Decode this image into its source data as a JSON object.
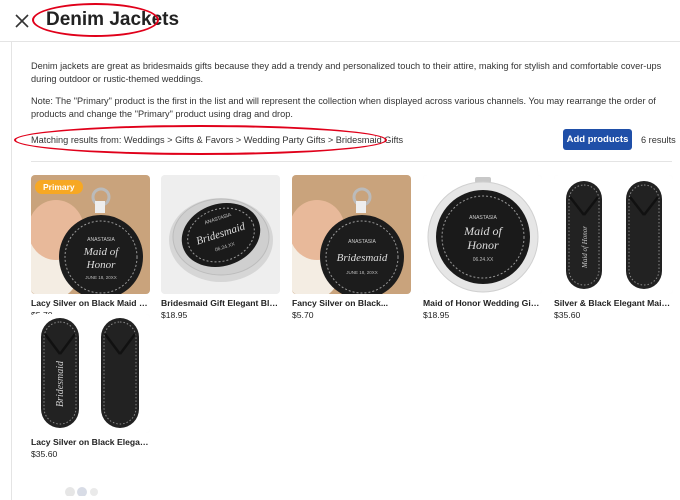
{
  "header": {
    "title": "Denim Jackets"
  },
  "description": {
    "paragraph1": "Denim jackets are great as bridesmaids gifts because they add a trendy and personalized touch to their attire, making for stylish and comfortable cover-ups during outdoor or rustic-themed weddings.",
    "paragraph2": "Note: The \"Primary\" product is the first in the list and will represent the collection when displayed across various channels. You may rearrange the order of products and change the \"Primary\" product using drag and drop."
  },
  "breadcrumb": "Matching results from: Weddings > Gifts & Favors > Wedding Party Gifts > Bridesmaid Gifts",
  "actions": {
    "add_products_label": "Add products",
    "results_count": "6 results"
  },
  "products": [
    {
      "name": "Lacy Silver on Black Maid of...",
      "price": "$5.70",
      "badge": "Primary",
      "image_text": [
        "ANASTASIA",
        "Maid of",
        "Honor",
        "JUNE 18, 20XX"
      ]
    },
    {
      "name": "Bridesmaid Gift Elegant Blac...",
      "price": "$18.95",
      "image_text": [
        "ANASTASIA",
        "Bridesmaid",
        "06.24.XX"
      ]
    },
    {
      "name": "Fancy Silver on Black...",
      "price": "$5.70",
      "image_text": [
        "ANASTASIA",
        "Bridesmaid",
        "JUNE 18, 20XX"
      ]
    },
    {
      "name": "Maid of Honor Wedding Gift...",
      "price": "$18.95",
      "image_text": [
        "ANASTASIA",
        "Maid of",
        "Honor",
        "06.24.XX"
      ]
    },
    {
      "name": "Silver & Black Elegant Maid o...",
      "price": "$35.60",
      "image_text": [
        "Maid of Honor"
      ]
    },
    {
      "name": "Lacy Silver on Black Elegant...",
      "price": "$35.60",
      "image_text": [
        "Bridesmaid"
      ]
    }
  ],
  "colors": {
    "accent": "#1f4fa8",
    "badge": "#f7a823",
    "annotation": "#e0001a"
  }
}
